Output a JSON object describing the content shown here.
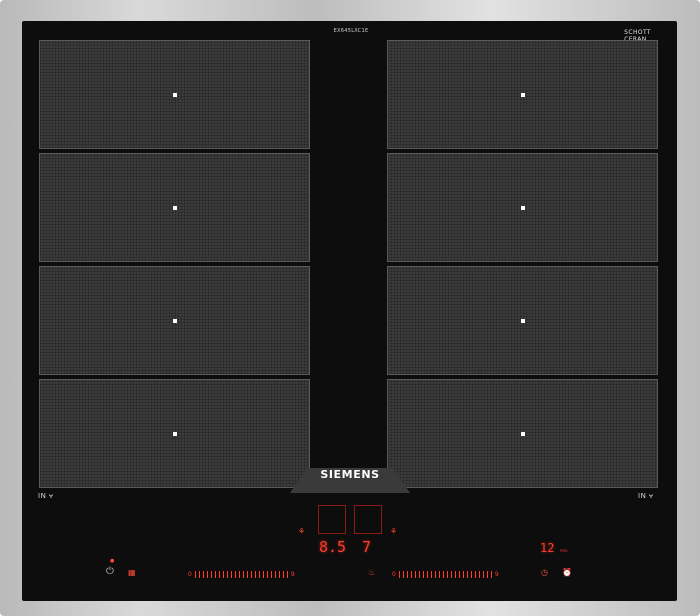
{
  "hob": {
    "brand": "SIEMENS",
    "model": "EX645LXC1E",
    "glass_brand_line1": "SCHOTT",
    "glass_brand_line2": "CERAN",
    "glass_brand_sub": "",
    "left_label": "IN",
    "right_label": "IN"
  },
  "zones": {
    "left": [
      "zone-1",
      "zone-2",
      "zone-3",
      "zone-4"
    ],
    "right": [
      "zone-1",
      "zone-2",
      "zone-3",
      "zone-4"
    ]
  },
  "controls": {
    "display_main": "8.5",
    "display_secondary": "7",
    "display_small_label": "",
    "timer_value": "12",
    "timer_unit": "min",
    "left_slider_start": "0",
    "left_slider_end": "9",
    "right_slider_start": "0",
    "right_slider_end": "9"
  },
  "icons": {
    "power": "power-icon",
    "child_lock": "grid-icon",
    "center": "pan-icon",
    "timer": "clock-icon",
    "alarm": "alarm-icon",
    "flame_left": "flame-icon",
    "flame_right": "flame-icon"
  },
  "colors": {
    "glass": "#0d0d0d",
    "zone": "#3b3b3b",
    "led": "#ff3b2b",
    "frame": "#c8c8c8"
  }
}
